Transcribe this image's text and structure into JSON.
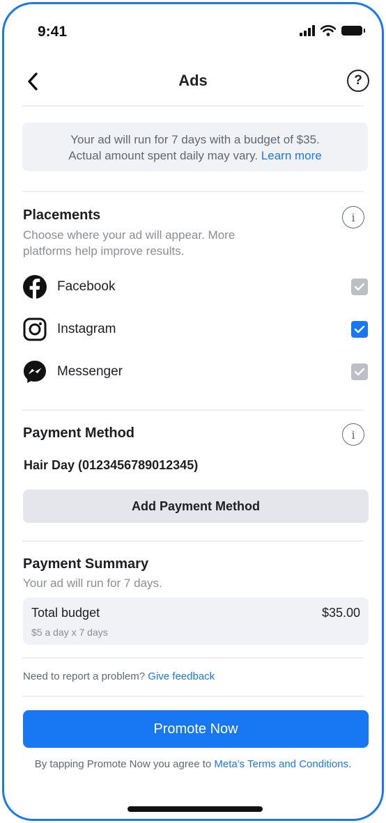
{
  "status_bar": {
    "time": "9:41"
  },
  "header": {
    "title": "Ads",
    "help_glyph": "?"
  },
  "notice": {
    "line1": "Your ad will run for 7 days with a budget of $35.",
    "line2": "Actual amount spent daily may vary.",
    "learn_more": "Learn more"
  },
  "placements": {
    "title": "Placements",
    "info_glyph": "i",
    "subtitle_line1": "Choose where your ad will appear. More",
    "subtitle_line2": "platforms help improve results.",
    "items": [
      {
        "label": "Facebook",
        "icon": "facebook-icon",
        "checked": true,
        "disabled": true
      },
      {
        "label": "Instagram",
        "icon": "instagram-icon",
        "checked": true,
        "disabled": false
      },
      {
        "label": "Messenger",
        "icon": "messenger-icon",
        "checked": true,
        "disabled": true
      }
    ]
  },
  "payment_method": {
    "title": "Payment Method",
    "info_glyph": "i",
    "account": "Hair Day (0123456789012345)",
    "add_button": "Add Payment Method"
  },
  "payment_summary": {
    "title": "Payment Summary",
    "subtitle": "Your ad will run for 7 days.",
    "total_label": "Total budget",
    "total_calc": "$5 a day x 7 days",
    "total_amount": "$35.00"
  },
  "feedback": {
    "text": "Need to report a problem?",
    "link": "Give feedback"
  },
  "promote_button": "Promote Now",
  "terms": {
    "text": "By tapping Promote Now you agree to",
    "link": "Meta's Terms and Conditions."
  },
  "colors": {
    "accent": "#1877f2",
    "disabled_checkbox": "#bcc0c4",
    "panel": "#f0f2f5"
  }
}
